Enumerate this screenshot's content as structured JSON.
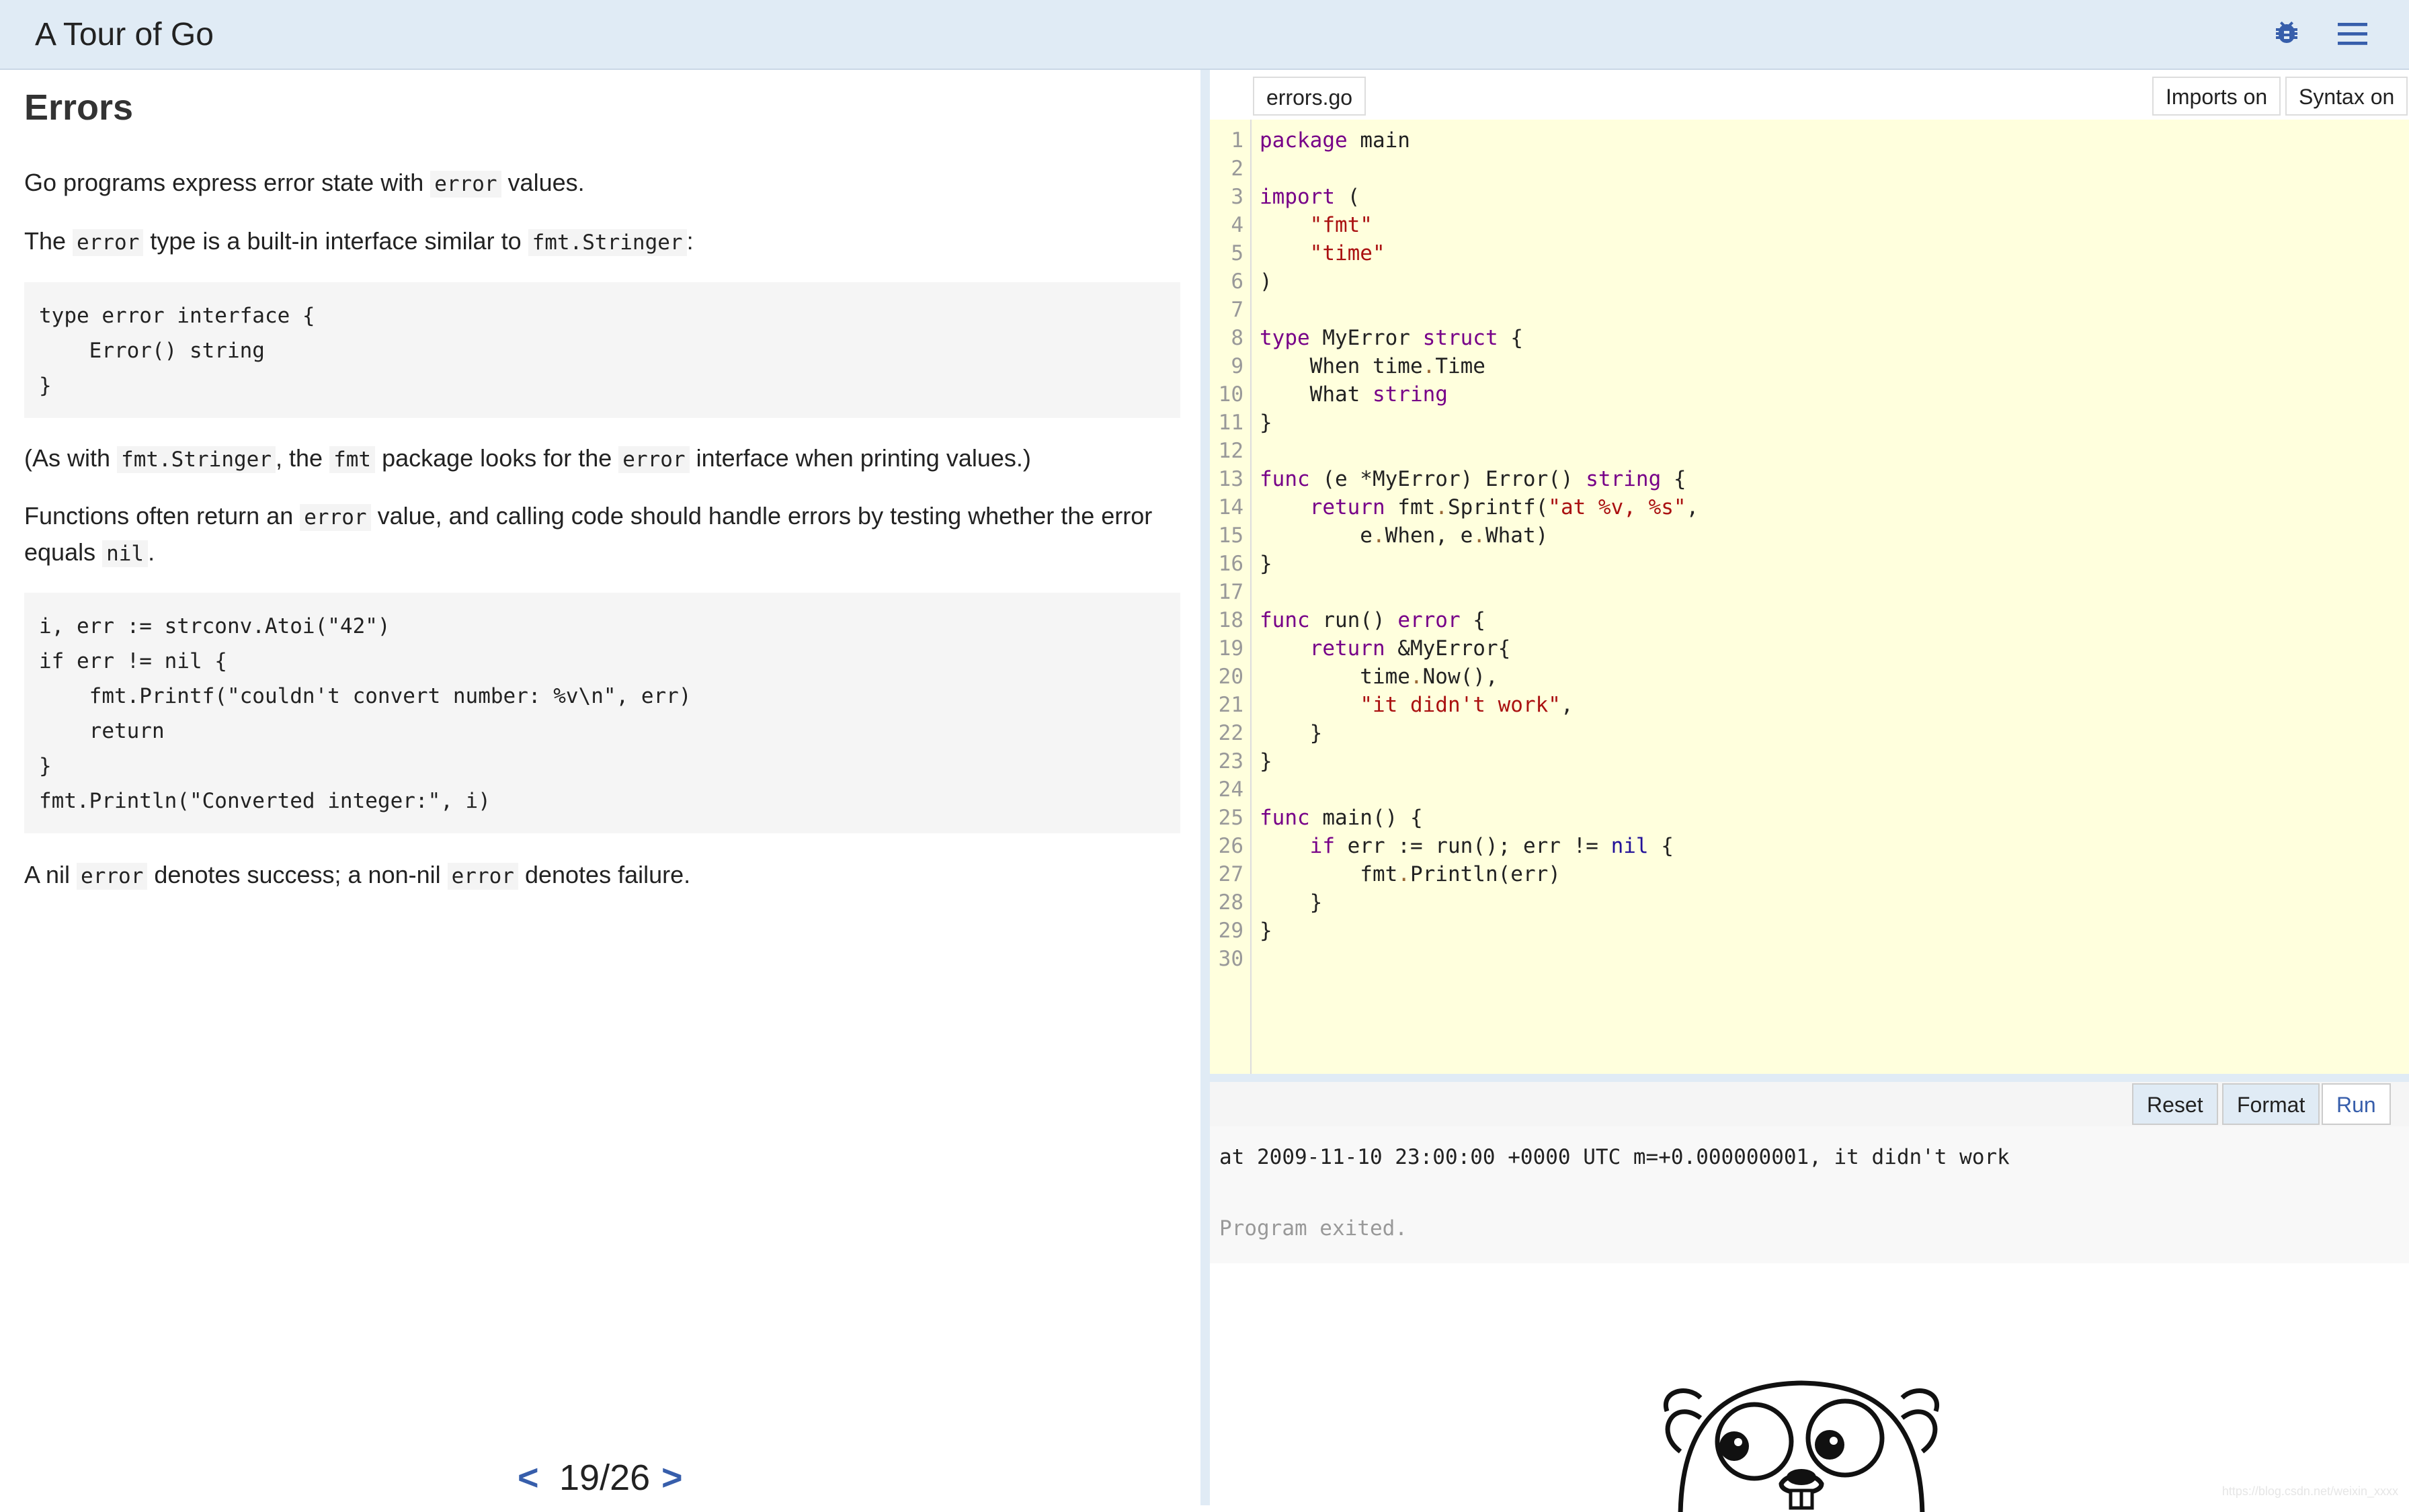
{
  "header": {
    "title": "A Tour of Go",
    "bug_icon": "bug-icon",
    "menu_icon": "hamburger-menu-icon",
    "background": "#e0ebf5"
  },
  "lesson": {
    "heading": "Errors",
    "p1": {
      "a": "Go programs express error state with ",
      "code": "error",
      "b": " values."
    },
    "p2": {
      "a": "The ",
      "code1": "error",
      "b": " type is a built-in interface similar to ",
      "code2": "fmt.Stringer",
      "c": ":"
    },
    "code_block_1": "type error interface {\n    Error() string\n}",
    "p3": {
      "a": "(As with ",
      "code1": "fmt.Stringer",
      "b": ", the ",
      "code2": "fmt",
      "c": " package looks for the ",
      "code3": "error",
      "d": " interface when printing values.)"
    },
    "p4": {
      "a": "Functions often return an ",
      "code1": "error",
      "b": " value, and calling code should handle errors by testing whether the error equals ",
      "code2": "nil",
      "c": "."
    },
    "code_block_2": "i, err := strconv.Atoi(\"42\")\nif err != nil {\n    fmt.Printf(\"couldn't convert number: %v\\n\", err)\n    return\n}\nfmt.Println(\"Converted integer:\", i)",
    "p5": {
      "a": "A nil ",
      "code1": "error",
      "b": " denotes success; a non-nil ",
      "code2": "error",
      "c": " denotes failure."
    }
  },
  "pager": {
    "prev": "<",
    "page": "19/26",
    "next": ">",
    "accent": "#375eab"
  },
  "editor": {
    "file_tab": "errors.go",
    "imports_btn": "Imports on",
    "syntax_btn": "Syntax on",
    "background": "#ffffdd",
    "lines": [
      "1",
      "2",
      "3",
      "4",
      "5",
      "6",
      "7",
      "8",
      "9",
      "10",
      "11",
      "12",
      "13",
      "14",
      "15",
      "16",
      "17",
      "18",
      "19",
      "20",
      "21",
      "22",
      "23",
      "24",
      "25",
      "26",
      "27",
      "28",
      "29",
      "30"
    ]
  },
  "toolbar": {
    "reset": "Reset",
    "format": "Format",
    "run": "Run"
  },
  "output": {
    "line1": "at 2009-11-10 23:00:00 +0000 UTC m=+0.000000001, it didn't work",
    "line2": "Program exited."
  },
  "watermark": "https://blog.csdn.net/weixin_xxxx"
}
